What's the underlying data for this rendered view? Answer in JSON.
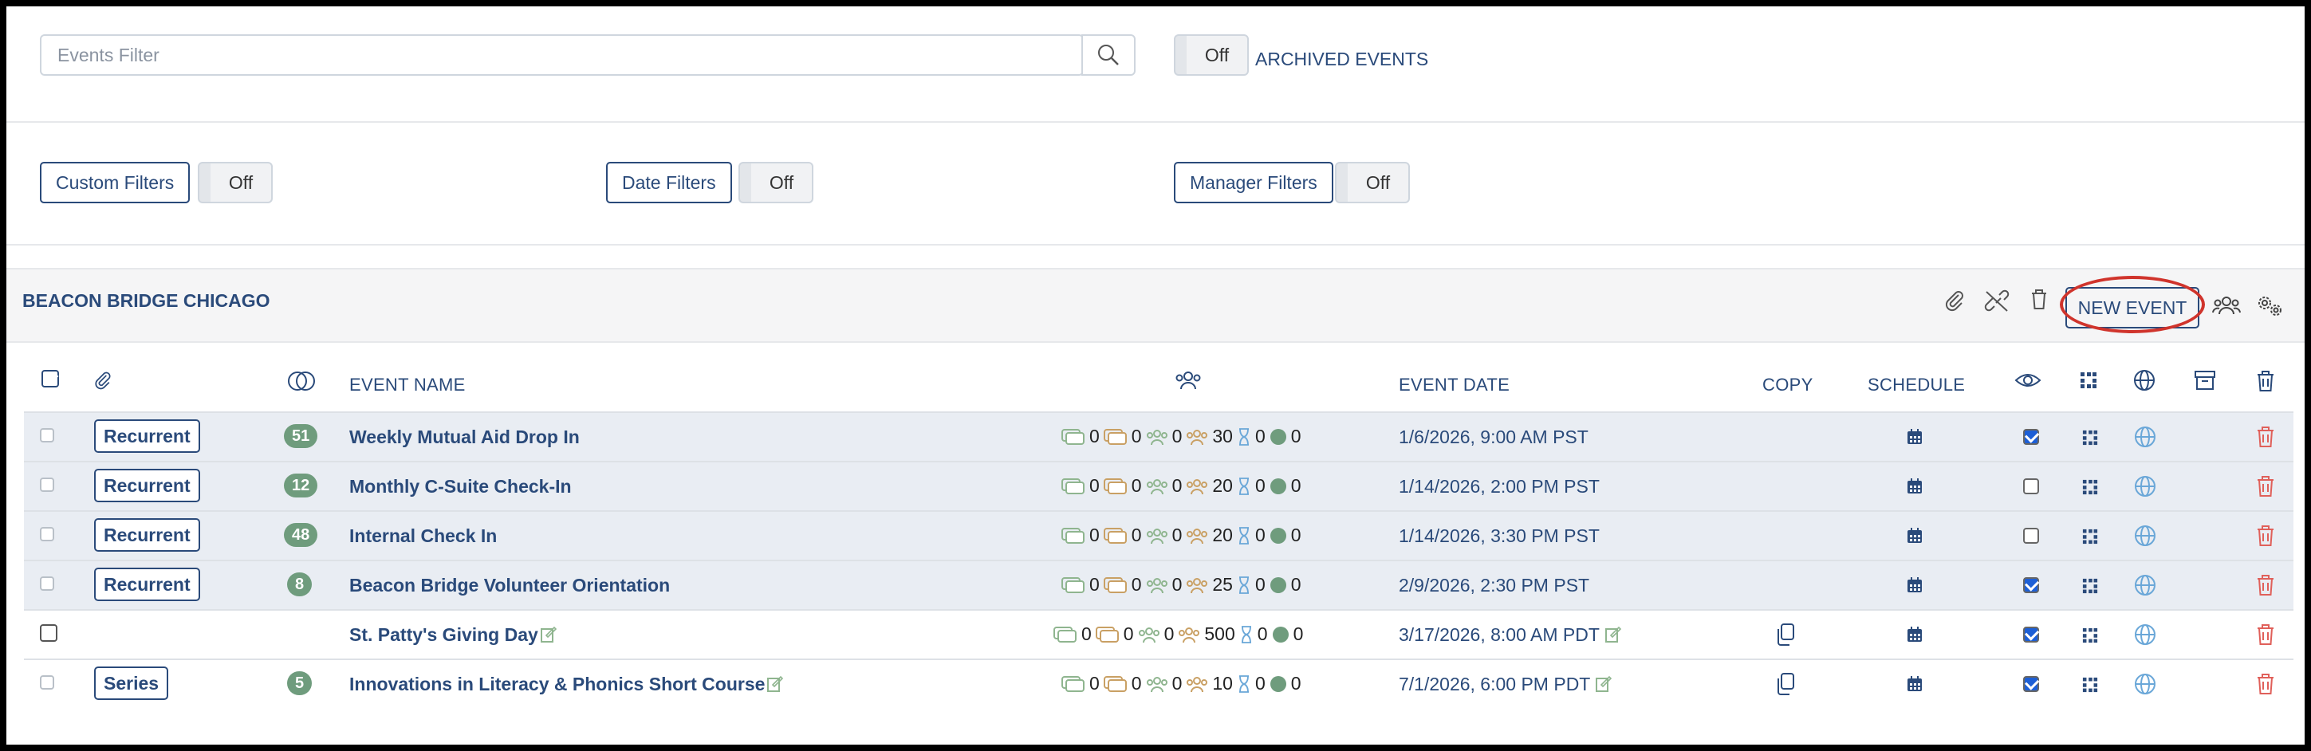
{
  "filter": {
    "placeholder": "Events Filter"
  },
  "archived": {
    "toggle": "Off",
    "label": "ARCHIVED EVENTS"
  },
  "custom_filters": {
    "label": "Custom Filters",
    "toggle": "Off"
  },
  "date_filters": {
    "label": "Date Filters",
    "toggle": "Off"
  },
  "manager_filters": {
    "label": "Manager Filters",
    "toggle": "Off"
  },
  "org": {
    "title": "BEACON BRIDGE CHICAGO",
    "new_event": "NEW EVENT"
  },
  "headers": {
    "event_name": "EVENT NAME",
    "event_date": "EVENT DATE",
    "copy": "COPY",
    "schedule": "SCHEDULE"
  },
  "colors": {
    "navy": "#2a4a7a",
    "pill": "#6f9c7d",
    "delete": "#e0605a",
    "globe": "#6aa7d8",
    "highlight": "#d0342c"
  },
  "rows": [
    {
      "type": "Recurrent",
      "count": "51",
      "name": "Weekly Mutual Aid Drop In",
      "s1": "0",
      "s2": "0",
      "s3": "0",
      "s4": "30",
      "s5": "0",
      "s6": "0",
      "date": "1/6/2026, 9:00 AM PST",
      "visible": true
    },
    {
      "type": "Recurrent",
      "count": "12",
      "name": "Monthly C-Suite Check-In",
      "s1": "0",
      "s2": "0",
      "s3": "0",
      "s4": "20",
      "s5": "0",
      "s6": "0",
      "date": "1/14/2026, 2:00 PM PST",
      "visible": false
    },
    {
      "type": "Recurrent",
      "count": "48",
      "name": "Internal Check In",
      "s1": "0",
      "s2": "0",
      "s3": "0",
      "s4": "20",
      "s5": "0",
      "s6": "0",
      "date": "1/14/2026, 3:30 PM PST",
      "visible": false
    },
    {
      "type": "Recurrent",
      "count": "8",
      "name": "Beacon Bridge Volunteer Orientation",
      "s1": "0",
      "s2": "0",
      "s3": "0",
      "s4": "25",
      "s5": "0",
      "s6": "0",
      "date": "2/9/2026, 2:30 PM PST",
      "visible": true
    },
    {
      "type": "",
      "count": "",
      "name": "St. Patty's Giving Day",
      "s1": "0",
      "s2": "0",
      "s3": "0",
      "s4": "500",
      "s5": "0",
      "s6": "0",
      "date": "3/17/2026, 8:00 AM PDT",
      "visible": true
    },
    {
      "type": "Series",
      "count": "5",
      "name": "Innovations in Literacy & Phonics Short Course",
      "s1": "0",
      "s2": "0",
      "s3": "0",
      "s4": "10",
      "s5": "0",
      "s6": "0",
      "date": "7/1/2026, 6:00 PM PDT",
      "visible": true
    }
  ]
}
